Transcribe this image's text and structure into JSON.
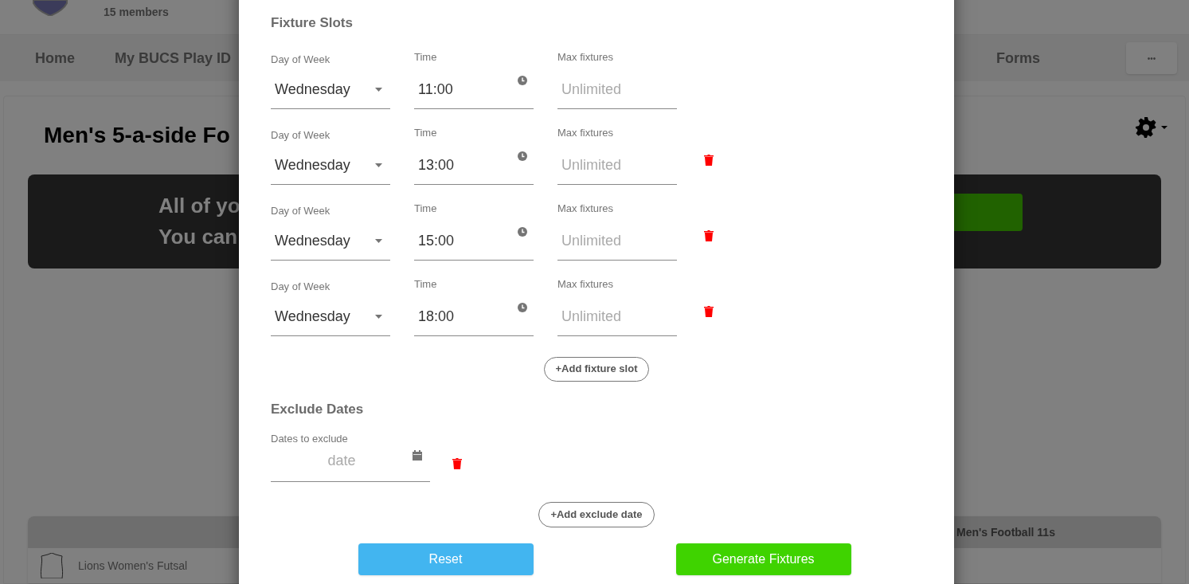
{
  "header": {
    "members": "15 members"
  },
  "nav": {
    "items": [
      {
        "label": "Home"
      },
      {
        "label": "My BUCS Play ID"
      },
      {
        "label": "Forms"
      }
    ],
    "more": "•••"
  },
  "page": {
    "title": "Men's 5-a-side Fo",
    "banner": [
      "All of yo",
      "You can"
    ]
  },
  "table": {
    "header": "Men's Football 11s",
    "rows": [
      "Lions Women's Futsal"
    ]
  },
  "modal": {
    "fixture_slots": {
      "title": "Fixture Slots",
      "slots": [
        {
          "day_label": "Day of Week",
          "day": "Wednesday",
          "time_label": "Time",
          "time": "11:00",
          "max_label": "Max fixtures",
          "max_placeholder": "Unlimited",
          "removable": false
        },
        {
          "day_label": "Day of Week",
          "day": "Wednesday",
          "time_label": "Time",
          "time": "13:00",
          "max_label": "Max fixtures",
          "max_placeholder": "Unlimited",
          "removable": true
        },
        {
          "day_label": "Day of Week",
          "day": "Wednesday",
          "time_label": "Time",
          "time": "15:00",
          "max_label": "Max fixtures",
          "max_placeholder": "Unlimited",
          "removable": true
        },
        {
          "day_label": "Day of Week",
          "day": "Wednesday",
          "time_label": "Time",
          "time": "18:00",
          "max_label": "Max fixtures",
          "max_placeholder": "Unlimited",
          "removable": true
        }
      ],
      "add_button": "+Add fixture slot"
    },
    "exclude_dates": {
      "title": "Exclude Dates",
      "label": "Dates to exclude",
      "placeholder": "date",
      "removable": true,
      "add_button": "+Add exclude date"
    },
    "buttons": [
      {
        "kind": "reset",
        "label": "Reset"
      },
      {
        "kind": "generate",
        "label": "Generate Fixtures"
      }
    ]
  }
}
